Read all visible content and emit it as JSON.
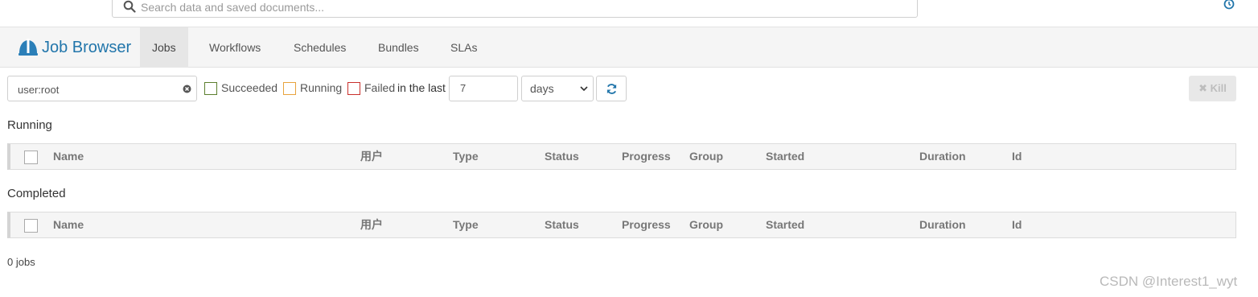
{
  "search": {
    "placeholder": "Search data and saved documents..."
  },
  "navbar": {
    "brand": "Job Browser",
    "tabs": [
      {
        "label": "Jobs",
        "active": true
      },
      {
        "label": "Workflows"
      },
      {
        "label": "Schedules"
      },
      {
        "label": "Bundles"
      },
      {
        "label": "SLAs"
      }
    ]
  },
  "filters": {
    "text": "user:root",
    "succeeded": "Succeeded",
    "running": "Running",
    "failed": "Failed",
    "in_the_last": "in the last",
    "days_value": "7",
    "unit": "days",
    "kill": "✖ Kill"
  },
  "colors": {
    "brand": "#2276ab",
    "succeeded": "#5c7f2e",
    "running": "#e8a33d",
    "failed": "#c9302c"
  },
  "sections": {
    "running": "Running",
    "completed": "Completed"
  },
  "columns": [
    "Name",
    "用户",
    "Type",
    "Status",
    "Progress",
    "Group",
    "Started",
    "Duration",
    "Id"
  ],
  "footer": {
    "count": "0 jobs"
  },
  "watermark": "CSDN @Interest1_wyt"
}
